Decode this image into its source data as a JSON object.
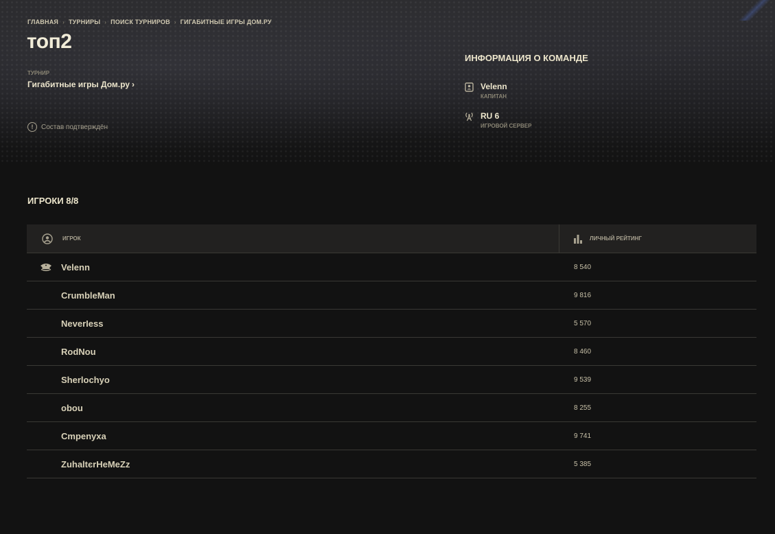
{
  "breadcrumb": [
    "ГЛАВНАЯ",
    "ТУРНИРЫ",
    "ПОИСК ТУРНИРОВ",
    "ГИГАБИТНЫЕ ИГРЫ ДОМ.РУ"
  ],
  "team_name": "топ2",
  "tournament": {
    "label": "ТУРНИР",
    "name": "Гигабитные игры Дом.ру",
    "arrow": "›"
  },
  "status": {
    "icon": "info-circle-icon",
    "text": "Состав подтверждён"
  },
  "team_info": {
    "title": "ИНФОРМАЦИЯ О КОМАНДЕ",
    "captain": {
      "icon": "id-card-icon",
      "value": "Velenn",
      "label": "КАПИТАН"
    },
    "server": {
      "icon": "antenna-icon",
      "value": "RU 6",
      "label": "ИГРОВОЙ СЕРВЕР"
    }
  },
  "players": {
    "title": "ИГРОКИ 8/8",
    "columns": {
      "player": "ИГРОК",
      "rating": "ЛИЧНЫЙ РЕЙТИНГ"
    },
    "rows": [
      {
        "name": "Velenn",
        "rating": "8 540",
        "captain": true
      },
      {
        "name": "CrumbleMan",
        "rating": "9 816",
        "captain": false
      },
      {
        "name": "NeverIess",
        "rating": "5 570",
        "captain": false
      },
      {
        "name": "RodNou",
        "rating": "8 460",
        "captain": false
      },
      {
        "name": "Sherlochyo",
        "rating": "9 539",
        "captain": false
      },
      {
        "name": "obou",
        "rating": "8 255",
        "captain": false
      },
      {
        "name": "Cmpenyxa",
        "rating": "9 741",
        "captain": false
      },
      {
        "name": "ZuhaltєrHeMeZz",
        "rating": "5 385",
        "captain": false
      }
    ]
  },
  "colors": {
    "background": "#121212",
    "text": "#ede6cc",
    "muted": "#8a8574",
    "header_bg": "#222120"
  }
}
